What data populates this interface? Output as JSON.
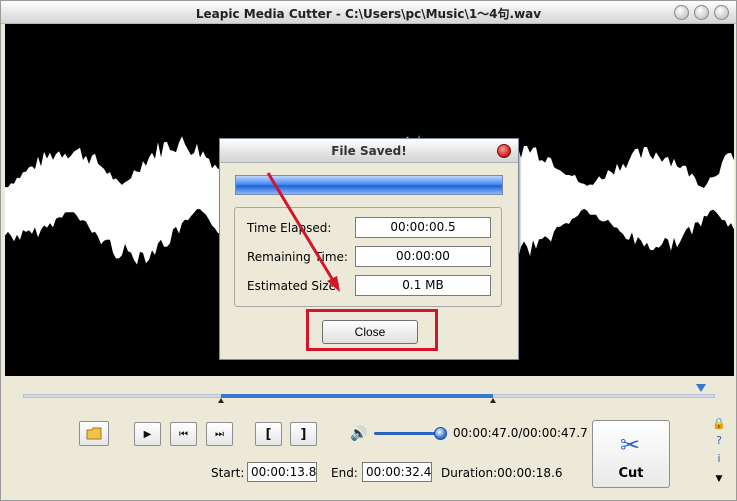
{
  "window": {
    "title": "Leapic Media Cutter - C:\\Users\\pc\\Music\\1～4句.wav"
  },
  "dialog": {
    "title": "File Saved!",
    "progress_fraction": 1.0,
    "fields": [
      {
        "label": "Time Elapsed:",
        "value": "00:00:00.5"
      },
      {
        "label": "Remaining Time:",
        "value": "00:00:00"
      },
      {
        "label": "Estimated Size:",
        "value": "0.1 MB"
      }
    ],
    "close_label": "Close"
  },
  "player": {
    "time_readout": "00:00:47.0/00:00:47.7",
    "start_label": "Start:",
    "start_value": "00:00:13.8",
    "end_label": "End:",
    "end_value": "00:00:32.4",
    "duration_text": "Duration:00:00:18.6",
    "cut_label": "Cut"
  },
  "icons": {
    "open": "folder-icon",
    "play": "play-icon",
    "prev": "skip-back-icon",
    "next": "skip-forward-icon",
    "mark_start": "bracket-open-icon",
    "mark_end": "bracket-close-icon",
    "volume": "speaker-icon",
    "cut": "scissors-icon"
  },
  "colors": {
    "accent": "#2b63c0",
    "highlight": "#d4142a",
    "waveform": "#ffffff",
    "wave_bg": "#000000"
  }
}
